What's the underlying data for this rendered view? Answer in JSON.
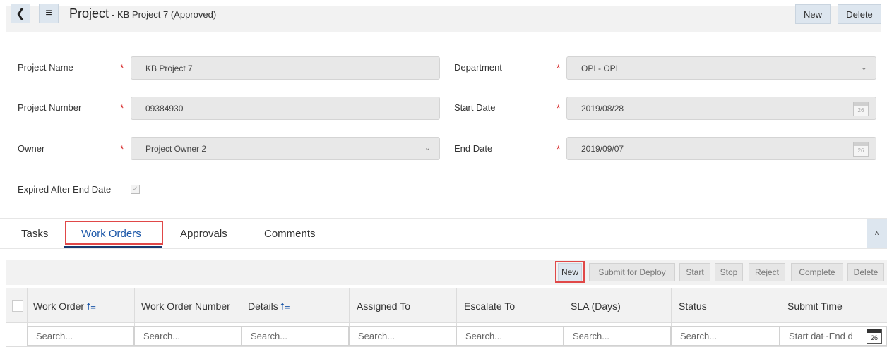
{
  "header": {
    "title": "Project",
    "subtitle": "- KB Project 7 (Approved)",
    "new_label": "New",
    "delete_label": "Delete"
  },
  "form": {
    "project_name": {
      "label": "Project Name",
      "value": "KB Project 7"
    },
    "project_number": {
      "label": "Project Number",
      "value": "09384930"
    },
    "owner": {
      "label": "Owner",
      "value": "Project Owner 2"
    },
    "department": {
      "label": "Department",
      "value": "OPI - OPI"
    },
    "start_date": {
      "label": "Start Date",
      "value": "2019/08/28"
    },
    "end_date": {
      "label": "End Date",
      "value": "2019/09/07"
    },
    "expired": {
      "label": "Expired After End Date",
      "checked": true
    },
    "required_mark": "*",
    "calendar_day": "26"
  },
  "tabs": [
    "Tasks",
    "Work Orders",
    "Approvals",
    "Comments"
  ],
  "active_tab": "Work Orders",
  "toolbar": [
    "New",
    "Submit for Deploy",
    "Start",
    "Stop",
    "Reject",
    "Complete",
    "Delete"
  ],
  "grid": {
    "columns": [
      "Work Order",
      "Work Order Number",
      "Details",
      "Assigned To",
      "Escalate To",
      "SLA (Days)",
      "Status",
      "Submit Time"
    ],
    "search_placeholder": "Search...",
    "submit_time_range": "Start dat~End d"
  },
  "icons": {
    "sort": "⭡≡"
  },
  "colors": {
    "accent": "#1a56a8",
    "highlight": "#e04848",
    "button_bg": "#dde6ef"
  }
}
